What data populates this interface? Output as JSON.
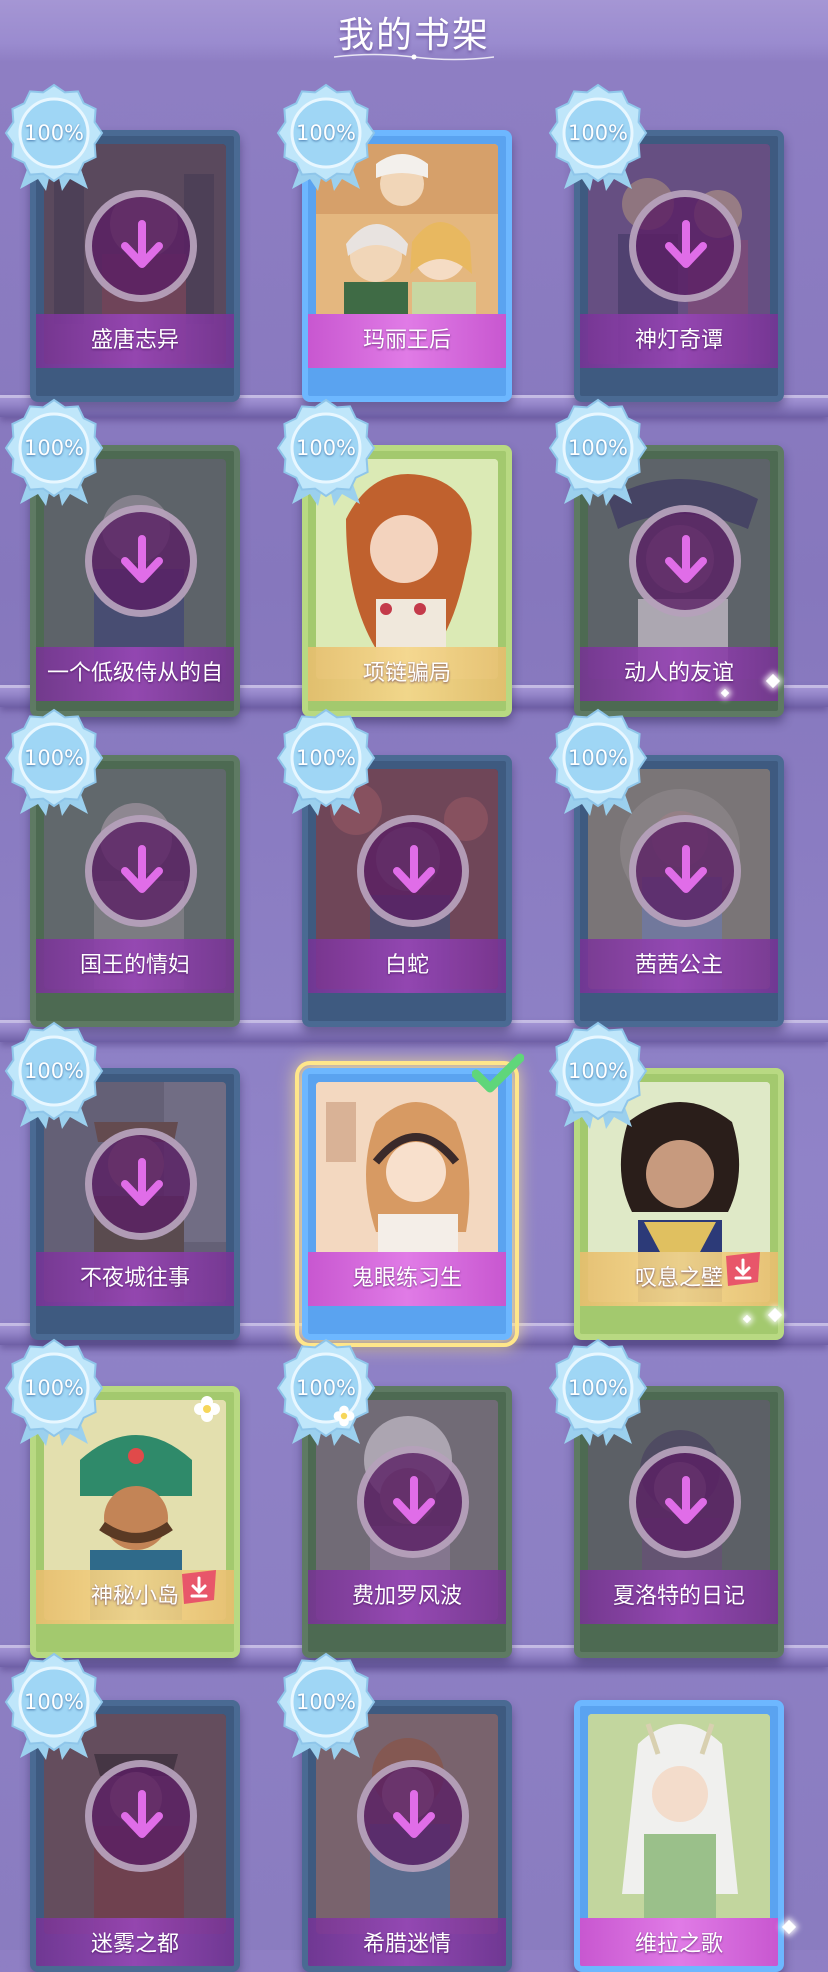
{
  "header": {
    "title": "我的书架"
  },
  "books": [
    {
      "title": "盛唐志异",
      "progress": "100%",
      "downloaded": false,
      "theme": "blue"
    },
    {
      "title": "玛丽王后",
      "progress": "100%",
      "downloaded": true,
      "theme": "blue"
    },
    {
      "title": "神灯奇谭",
      "progress": "100%",
      "downloaded": false,
      "theme": "blue"
    },
    {
      "title": "一个低级侍从的自",
      "progress": "100%",
      "downloaded": false,
      "theme": "green"
    },
    {
      "title": "项链骗局",
      "progress": "100%",
      "downloaded": true,
      "theme": "lime"
    },
    {
      "title": "动人的友谊",
      "progress": "100%",
      "downloaded": false,
      "theme": "green"
    },
    {
      "title": "国王的情妇",
      "progress": "100%",
      "downloaded": false,
      "theme": "green"
    },
    {
      "title": "白蛇",
      "progress": "100%",
      "downloaded": false,
      "theme": "blue"
    },
    {
      "title": "茜茜公主",
      "progress": "100%",
      "downloaded": false,
      "theme": "blue"
    },
    {
      "title": "不夜城往事",
      "progress": "100%",
      "downloaded": false,
      "theme": "blue"
    },
    {
      "title": "鬼眼练习生",
      "progress": "",
      "downloaded": true,
      "theme": "blue",
      "selected": true
    },
    {
      "title": "叹息之壁",
      "progress": "100%",
      "downloaded": true,
      "theme": "lime"
    },
    {
      "title": "神秘小岛",
      "progress": "100%",
      "downloaded": true,
      "theme": "lime"
    },
    {
      "title": "费加罗风波",
      "progress": "100%",
      "downloaded": false,
      "theme": "green"
    },
    {
      "title": "夏洛特的日记",
      "progress": "100%",
      "downloaded": false,
      "theme": "green"
    },
    {
      "title": "迷雾之都",
      "progress": "100%",
      "downloaded": false,
      "theme": "blue"
    },
    {
      "title": "希腊迷情",
      "progress": "100%",
      "downloaded": false,
      "theme": "blue"
    },
    {
      "title": "维拉之歌",
      "progress": "",
      "downloaded": true,
      "theme": "blue"
    }
  ],
  "colors": {
    "background": "#8a7cc0",
    "badge": "#8fd0f3",
    "download_arrow": "#e06de8",
    "selected_glow": "#ffe68a",
    "check": "#5fd67a"
  }
}
